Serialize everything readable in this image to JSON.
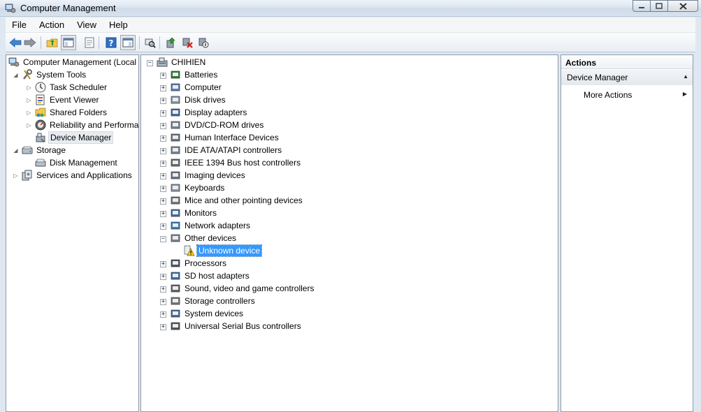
{
  "window": {
    "title": "Computer Management"
  },
  "menu": [
    "File",
    "Action",
    "View",
    "Help"
  ],
  "left_tree": {
    "root": "Computer Management (Local",
    "system_tools": "System Tools",
    "task_scheduler": "Task Scheduler",
    "event_viewer": "Event Viewer",
    "shared_folders": "Shared Folders",
    "reliability": "Reliability and Performa",
    "device_manager": "Device Manager",
    "storage": "Storage",
    "disk_management": "Disk Management",
    "services": "Services and Applications"
  },
  "device_tree": {
    "computer": "CHIHIEN",
    "categories": [
      "Batteries",
      "Computer",
      "Disk drives",
      "Display adapters",
      "DVD/CD-ROM drives",
      "Human Interface Devices",
      "IDE ATA/ATAPI controllers",
      "IEEE 1394 Bus host controllers",
      "Imaging devices",
      "Keyboards",
      "Mice and other pointing devices",
      "Monitors",
      "Network adapters",
      "Other devices",
      "Processors",
      "SD host adapters",
      "Sound, video and game controllers",
      "Storage controllers",
      "System devices",
      "Universal Serial Bus controllers"
    ],
    "unknown_device": "Unknown device"
  },
  "actions": {
    "header": "Actions",
    "section": "Device Manager",
    "more": "More Actions"
  },
  "colors": {
    "selection": "#3399ff",
    "window_frame": "#dfe8f2"
  }
}
